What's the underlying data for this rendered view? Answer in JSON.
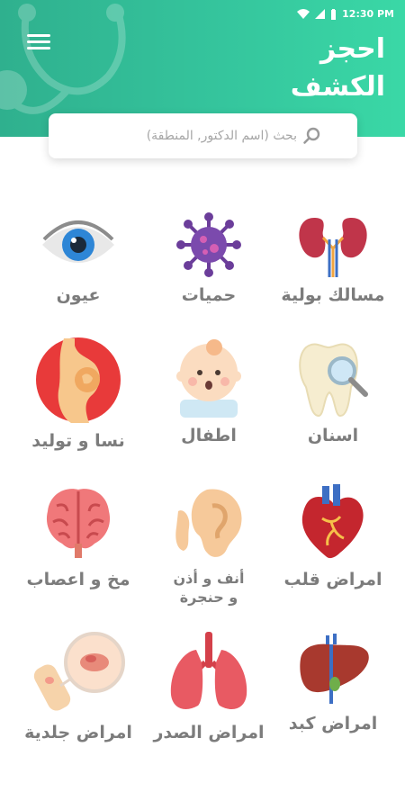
{
  "status": {
    "time": "12:30 PM"
  },
  "header": {
    "title_line1": "احجز",
    "title_line2": "الكشف"
  },
  "search": {
    "placeholder": "بحث (اسم الدكتور, المنطقة)"
  },
  "categories": [
    {
      "label": "مسالك بولية",
      "icon": "kidneys-icon"
    },
    {
      "label": "حميات",
      "icon": "virus-icon"
    },
    {
      "label": "عيون",
      "icon": "eye-icon"
    },
    {
      "label": "اسنان",
      "icon": "tooth-icon"
    },
    {
      "label": "اطفال",
      "icon": "baby-icon"
    },
    {
      "label": "نسا و توليد",
      "icon": "pregnancy-icon"
    },
    {
      "label": "امراض قلب",
      "icon": "heart-icon"
    },
    {
      "label_line1": "أنف و أذن",
      "label_line2": "و حنجرة",
      "icon": "ear-icon"
    },
    {
      "label": "مخ و اعصاب",
      "icon": "brain-icon"
    },
    {
      "label": "امراض كبد",
      "icon": "liver-icon"
    },
    {
      "label": "امراض الصدر",
      "icon": "lungs-icon"
    },
    {
      "label": "امراض جلدية",
      "icon": "skin-icon"
    }
  ],
  "colors": {
    "header_start": "#2fb08e",
    "header_end": "#3ad8a6",
    "label": "#7c7c7c"
  }
}
